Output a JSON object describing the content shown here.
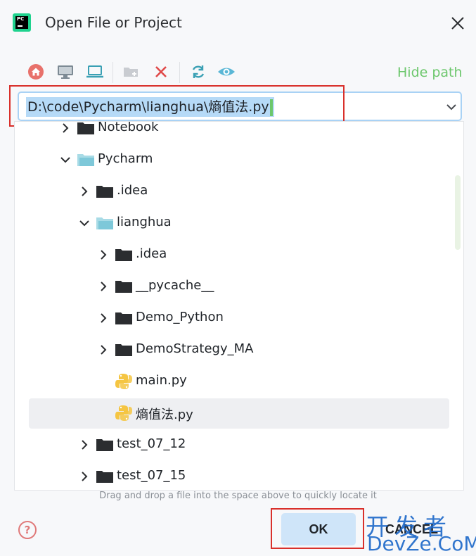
{
  "window": {
    "app_icon": "pycharm-icon",
    "app_icon_text": "PC",
    "title": "Open File or Project"
  },
  "toolbar": {
    "icons": [
      "home-icon",
      "desktop-icon",
      "laptop-icon",
      "new-folder-icon",
      "delete-icon",
      "refresh-icon",
      "show-hidden-icon"
    ],
    "hide_path_label": "Hide path"
  },
  "path_field": {
    "value": "D:\\code\\Pycharm\\lianghua\\熵值法.py"
  },
  "tree": {
    "items": [
      {
        "label": "Notebook",
        "type": "folder",
        "expanded": false
      },
      {
        "label": "Pycharm",
        "type": "module-folder",
        "expanded": true
      },
      {
        "label": ".idea",
        "type": "folder",
        "expanded": false
      },
      {
        "label": "lianghua",
        "type": "module-folder",
        "expanded": true
      },
      {
        "label": ".idea",
        "type": "folder",
        "expanded": false
      },
      {
        "label": "__pycache__",
        "type": "folder",
        "expanded": false
      },
      {
        "label": "Demo_Python",
        "type": "folder",
        "expanded": false
      },
      {
        "label": "DemoStrategy_MA",
        "type": "folder",
        "expanded": false
      },
      {
        "label": "main.py",
        "type": "python-file"
      },
      {
        "label": "熵值法.py",
        "type": "python-file",
        "selected": true
      },
      {
        "label": "test_07_12",
        "type": "folder",
        "expanded": false
      },
      {
        "label": "test_07_15",
        "type": "folder",
        "expanded": false
      }
    ]
  },
  "hint": "Drag and drop a file into the space above to quickly locate it",
  "footer": {
    "help_label": "?",
    "ok_label": "OK",
    "cancel_label": "CANCEL"
  },
  "watermark": {
    "line1": "开发者",
    "line2": "DevZe.CoM"
  },
  "colors": {
    "accent_green": "#6cc76c",
    "selection_blue": "#b6daf7",
    "ok_button": "#cfe5f9",
    "highlight_red": "#d9302b",
    "folder_dark": "#2b2d30",
    "module_folder": "#7ec8d9",
    "python_yellow": "#f5c542"
  }
}
